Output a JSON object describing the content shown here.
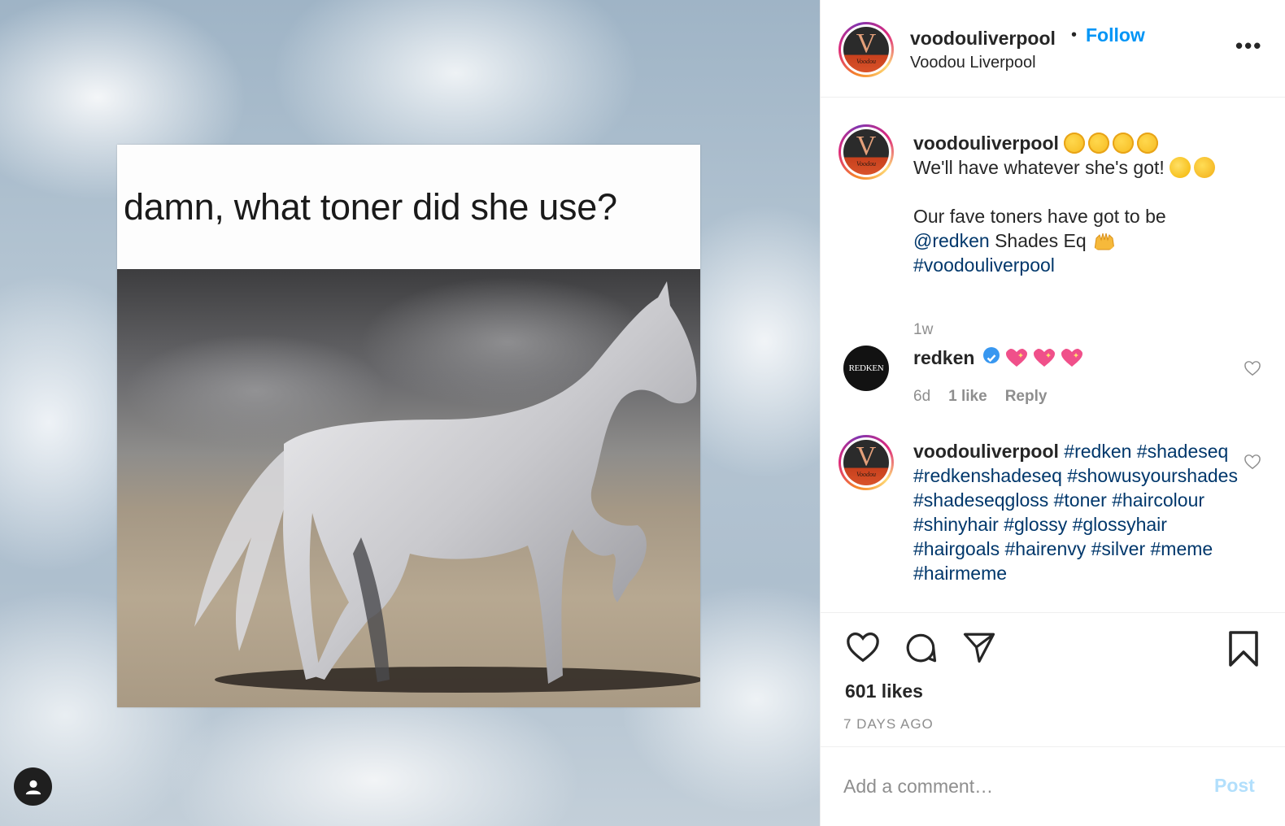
{
  "media": {
    "meme_caption": "damn, what toner did she use?"
  },
  "header": {
    "username": "voodouliverpool",
    "separator": "•",
    "follow_label": "Follow",
    "subtitle": "Voodou Liverpool",
    "more_label": "•••",
    "avatar_logo_text": "Voodou"
  },
  "caption": {
    "username": "voodouliverpool",
    "line1": "We'll have whatever she's got!",
    "line2": "Our fave toners have got to be",
    "mention": "@redken",
    "line3": " Shades Eq",
    "hashtag": "#voodouliverpool",
    "time": "1w"
  },
  "comments": [
    {
      "username": "redken",
      "avatar_text": "REDKEN",
      "time": "6d",
      "likes": "1 like",
      "reply_label": "Reply"
    },
    {
      "username": "voodouliverpool",
      "hashtags": "#redken #shadeseq #redkenshadeseq #showusyourshades #shadeseqgloss #toner #haircolour #shinyhair #glossy #glossyhair #hairgoals #hairenvy #silver #meme #hairmeme"
    }
  ],
  "actions": {
    "likes": "601 likes",
    "time_ago": "7 DAYS AGO"
  },
  "comment_bar": {
    "placeholder": "Add a comment…",
    "post_label": "Post"
  },
  "colors": {
    "link_blue": "#0095f6",
    "hashtag_blue": "#00376b",
    "muted": "#8e8e8e",
    "post_disabled": "#b2dffc"
  },
  "icons": [
    "heart-icon",
    "comment-icon",
    "share-icon",
    "bookmark-icon",
    "more-icon",
    "verified-icon",
    "user-icon"
  ]
}
